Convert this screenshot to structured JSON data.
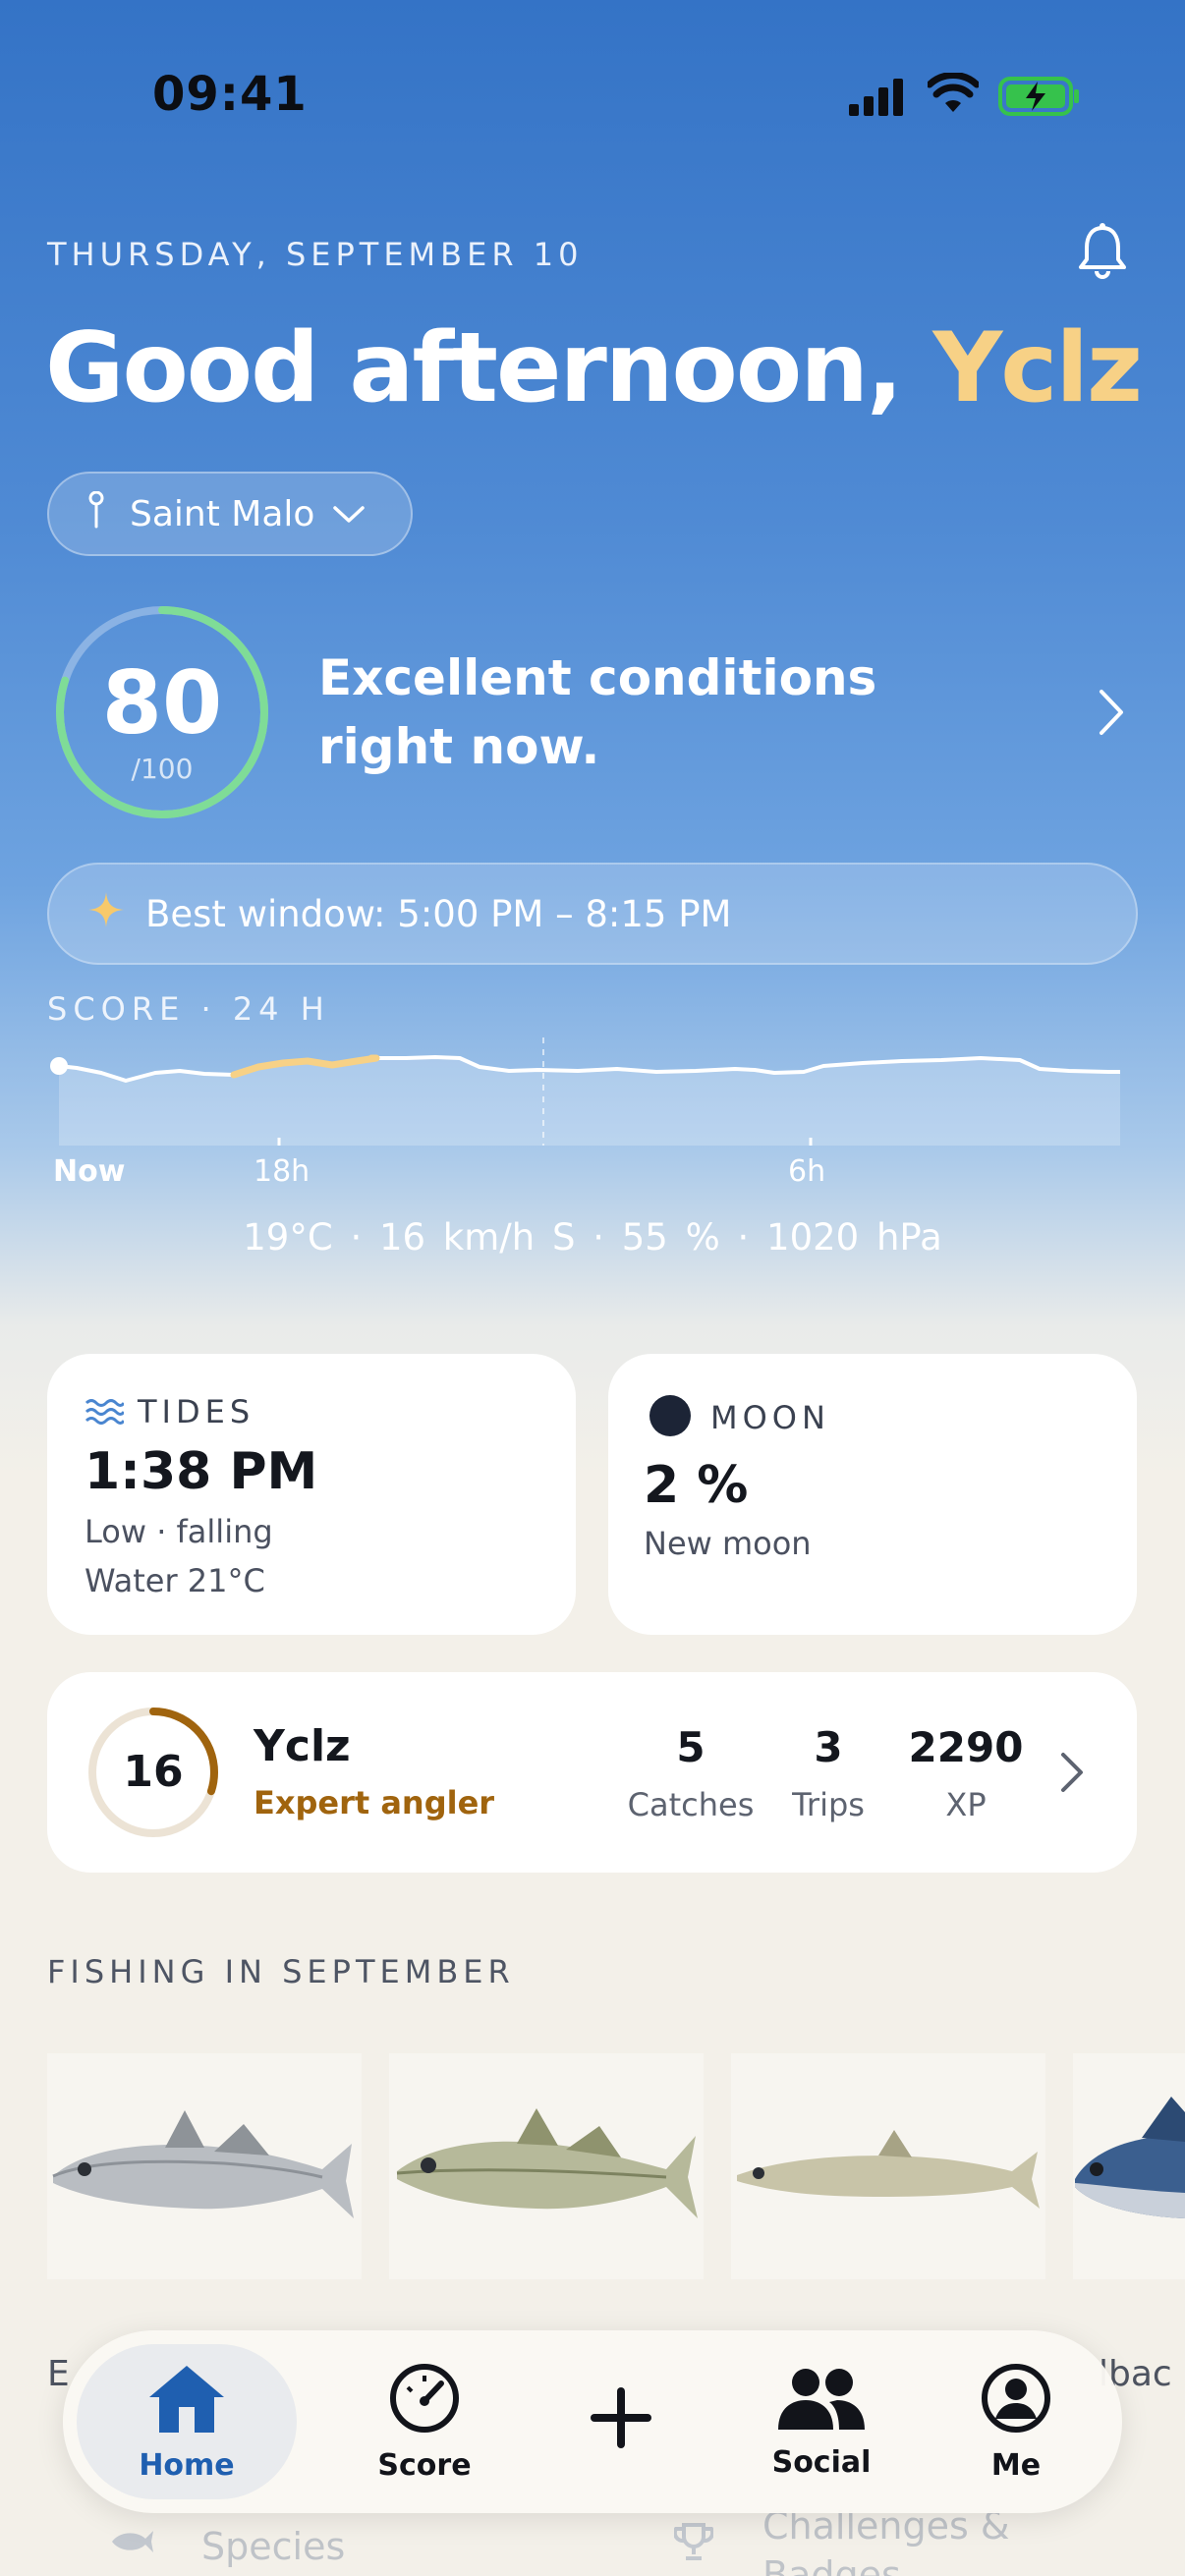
{
  "status_bar": {
    "time": "09:41"
  },
  "header": {
    "date": "THURSDAY, SEPTEMBER 10",
    "greeting": "Good afternoon,",
    "user_name": "Yclz",
    "location": "Saint Malo"
  },
  "score": {
    "value": "80",
    "max": "/100",
    "fraction": 0.8,
    "message": "Excellent conditions right now.",
    "best_window": "Best window: 5:00 PM – 8:15 PM"
  },
  "score_chart": {
    "label": "SCORE · 24 H",
    "ticks": [
      "Now",
      "18h",
      "6h"
    ]
  },
  "weather": {
    "temp": "19°C",
    "wind": "16 km/h S",
    "humidity": "55 %",
    "pressure": "1020 hPa"
  },
  "tides": {
    "label": "TIDES",
    "time": "1:38 PM",
    "state": "Low · falling",
    "water": "Water 21°C"
  },
  "moon": {
    "label": "MOON",
    "percent": "2 %",
    "phase": "New moon"
  },
  "profile": {
    "level": "16",
    "level_progress": 0.3,
    "name": "Yclz",
    "title": "Expert angler",
    "catches": "5",
    "catches_label": "Catches",
    "trips": "3",
    "trips_label": "Trips",
    "xp": "2290",
    "xp_label": "XP"
  },
  "species_section": {
    "title": "FISHING IN SEPTEMBER",
    "first_label_fragment": "E",
    "last_label_fragment": "lbac"
  },
  "under_nav": {
    "species": "Species",
    "challenges_line1": "Challenges &",
    "challenges_line2": "Badges"
  },
  "nav": {
    "home": "Home",
    "score": "Score",
    "social": "Social",
    "me": "Me"
  },
  "colors": {
    "accent_yellow": "#f7d186",
    "ring_green": "#7fdc97",
    "home_blue": "#1f5fb0",
    "level_brown": "#a0640e"
  }
}
